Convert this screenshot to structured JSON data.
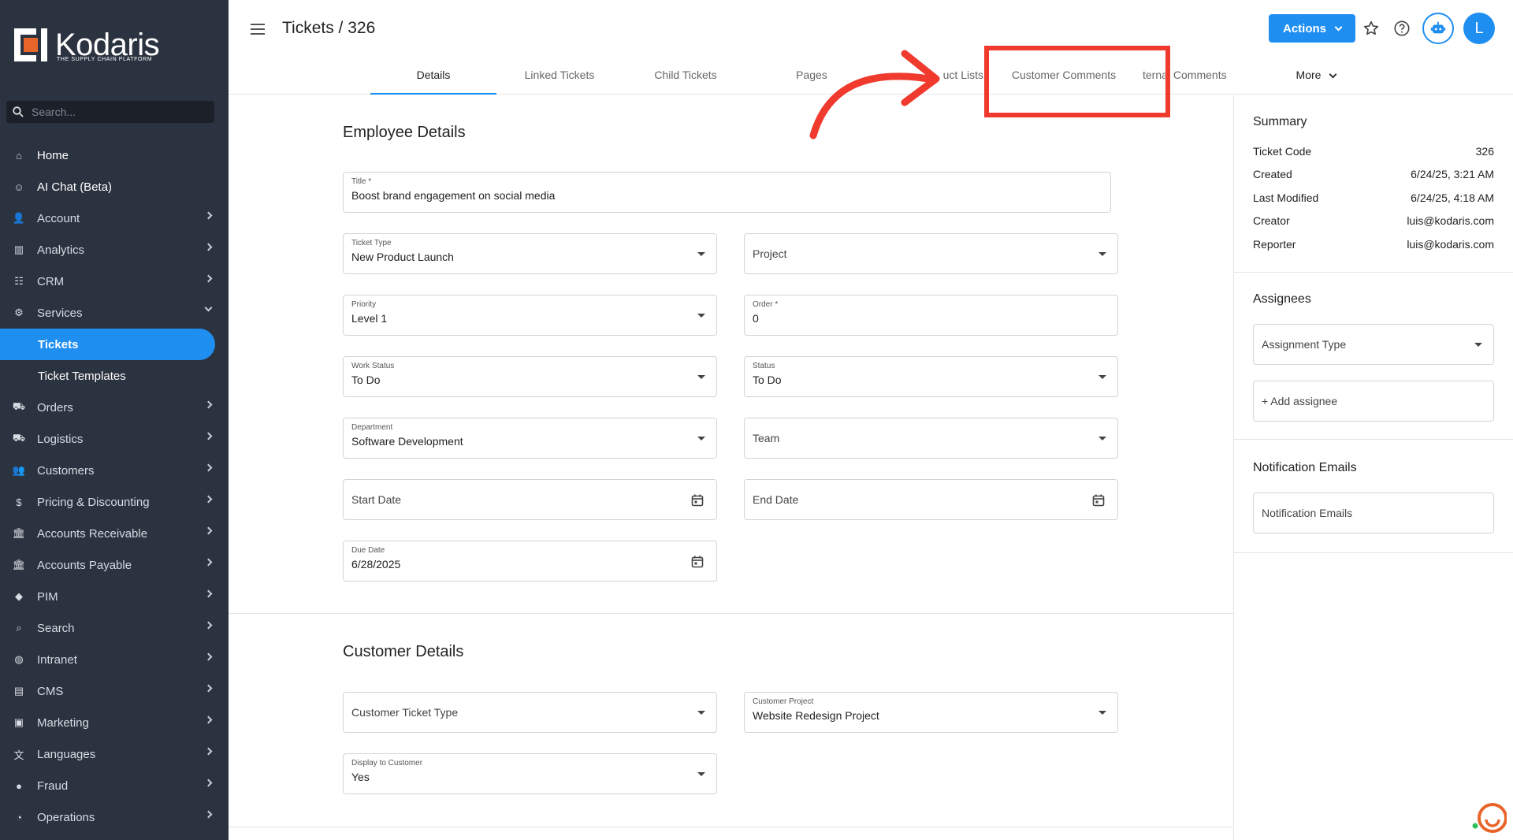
{
  "sidebar": {
    "brand": "Kodaris",
    "tagline": "THE SUPPLY CHAIN PLATFORM",
    "search_placeholder": "Search...",
    "items": [
      {
        "label": "Home",
        "icon": "home-icon",
        "glyph": "⌂"
      },
      {
        "label": "AI Chat (Beta)",
        "icon": "robot-icon",
        "glyph": "☺"
      },
      {
        "label": "Account",
        "icon": "person-icon",
        "glyph": "👤"
      },
      {
        "label": "Analytics",
        "icon": "chart-icon",
        "glyph": "▥"
      },
      {
        "label": "CRM",
        "icon": "contacts-icon",
        "glyph": "☷"
      },
      {
        "label": "Services",
        "icon": "gears-icon",
        "glyph": "⚙"
      },
      {
        "label": "Tickets"
      },
      {
        "label": "Ticket Templates"
      },
      {
        "label": "Orders",
        "icon": "truck-icon",
        "glyph": "⛟"
      },
      {
        "label": "Logistics",
        "icon": "shipping-icon",
        "glyph": "⛟"
      },
      {
        "label": "Customers",
        "icon": "people-icon",
        "glyph": "👥"
      },
      {
        "label": "Pricing & Discounting",
        "icon": "dollar-icon",
        "glyph": "$"
      },
      {
        "label": "Accounts Receivable",
        "icon": "bank-icon",
        "glyph": "🏛"
      },
      {
        "label": "Accounts Payable",
        "icon": "bank-icon",
        "glyph": "🏛"
      },
      {
        "label": "PIM",
        "icon": "tag-icon",
        "glyph": "◆"
      },
      {
        "label": "Search",
        "icon": "search-icon",
        "glyph": "⌕"
      },
      {
        "label": "Intranet",
        "icon": "globe-icon",
        "glyph": "◍"
      },
      {
        "label": "CMS",
        "icon": "cms-icon",
        "glyph": "▤"
      },
      {
        "label": "Marketing",
        "icon": "marketing-icon",
        "glyph": "▣"
      },
      {
        "label": "Languages",
        "icon": "translate-icon",
        "glyph": "文"
      },
      {
        "label": "Fraud",
        "icon": "alert-icon",
        "glyph": "●"
      },
      {
        "label": "Operations",
        "icon": "operations-icon",
        "glyph": "◔"
      }
    ]
  },
  "header": {
    "title": "Tickets / 326",
    "actions_label": "Actions",
    "avatar_initial": "L",
    "tabs": [
      "Details",
      "Linked Tickets",
      "Child Tickets",
      "Pages",
      "uct Lists",
      "Customer Comments",
      "ternal Comments",
      "More"
    ]
  },
  "employee": {
    "section_title": "Employee Details",
    "title_label": "Title *",
    "title_value": "Boost brand engagement on social media",
    "ticket_type_label": "Ticket Type",
    "ticket_type_value": "New Product Launch",
    "project_placeholder": "Project",
    "priority_label": "Priority",
    "priority_value": "Level 1",
    "order_label": "Order *",
    "order_value": "0",
    "work_status_label": "Work Status",
    "work_status_value": "To Do",
    "status_label": "Status",
    "status_value": "To Do",
    "department_label": "Department",
    "department_value": "Software Development",
    "team_placeholder": "Team",
    "start_date_placeholder": "Start Date",
    "end_date_placeholder": "End Date",
    "due_date_label": "Due Date",
    "due_date_value": "6/28/2025"
  },
  "customer": {
    "section_title": "Customer Details",
    "ticket_type_placeholder": "Customer Ticket Type",
    "project_label": "Customer Project",
    "project_value": "Website Redesign Project",
    "display_label": "Display to Customer",
    "display_value": "Yes"
  },
  "summary": {
    "title": "Summary",
    "rows": [
      {
        "key": "Ticket Code",
        "value": "326"
      },
      {
        "key": "Created",
        "value": "6/24/25, 3:21 AM"
      },
      {
        "key": "Last Modified",
        "value": "6/24/25, 4:18 AM"
      },
      {
        "key": "Creator",
        "value": "luis@kodaris.com"
      },
      {
        "key": "Reporter",
        "value": "luis@kodaris.com"
      }
    ]
  },
  "assignees": {
    "title": "Assignees",
    "type_placeholder": "Assignment Type",
    "add_label": "+ Add assignee"
  },
  "notifications": {
    "title": "Notification Emails",
    "placeholder": "Notification Emails"
  },
  "colors": {
    "accent": "#1f8ef1",
    "sidebar": "#2c3340",
    "annotation": "#f03a2e",
    "logo_orange": "#e8652a"
  }
}
